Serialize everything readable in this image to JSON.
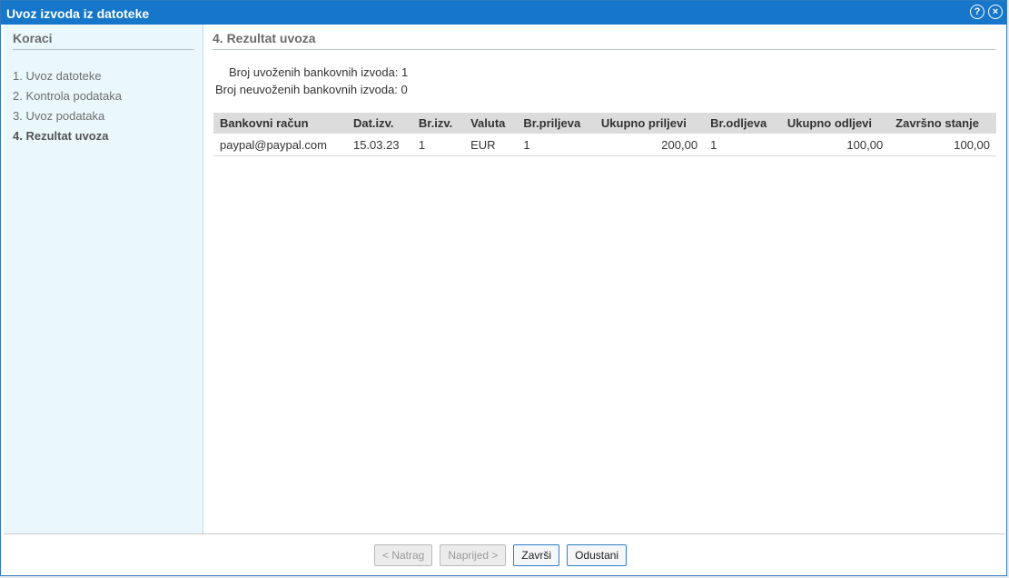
{
  "dialog": {
    "title": "Uvoz izvoda iz datoteke",
    "help_icon": "question-circle-icon",
    "close_icon": "close-circle-icon"
  },
  "sidebar": {
    "title": "Koraci",
    "steps": [
      {
        "label": "1. Uvoz datoteke"
      },
      {
        "label": "2. Kontrola podataka"
      },
      {
        "label": "3. Uvoz podataka"
      },
      {
        "label": "4. Rezultat uvoza",
        "active": true
      }
    ]
  },
  "main": {
    "title": "4. Rezultat uvoza",
    "imported_label": "Broj uvoženih bankovnih izvoda: 1",
    "not_imported_label": "Broj neuvoženih bankovnih izvoda: 0"
  },
  "table": {
    "columns": [
      "Bankovni račun",
      "Dat.izv.",
      "Br.izv.",
      "Valuta",
      "Br.priljeva",
      "Ukupno priljevi",
      "Br.odljeva",
      "Ukupno odljevi",
      "Završno stanje"
    ],
    "rows": [
      [
        "paypal@paypal.com",
        "15.03.23",
        "1",
        "EUR",
        "1",
        "200,00",
        "1",
        "100,00",
        "100,00"
      ]
    ]
  },
  "footer": {
    "back_label": "< Natrag",
    "next_label": "Naprijed >",
    "finish_label": "Završi",
    "cancel_label": "Odustani"
  }
}
